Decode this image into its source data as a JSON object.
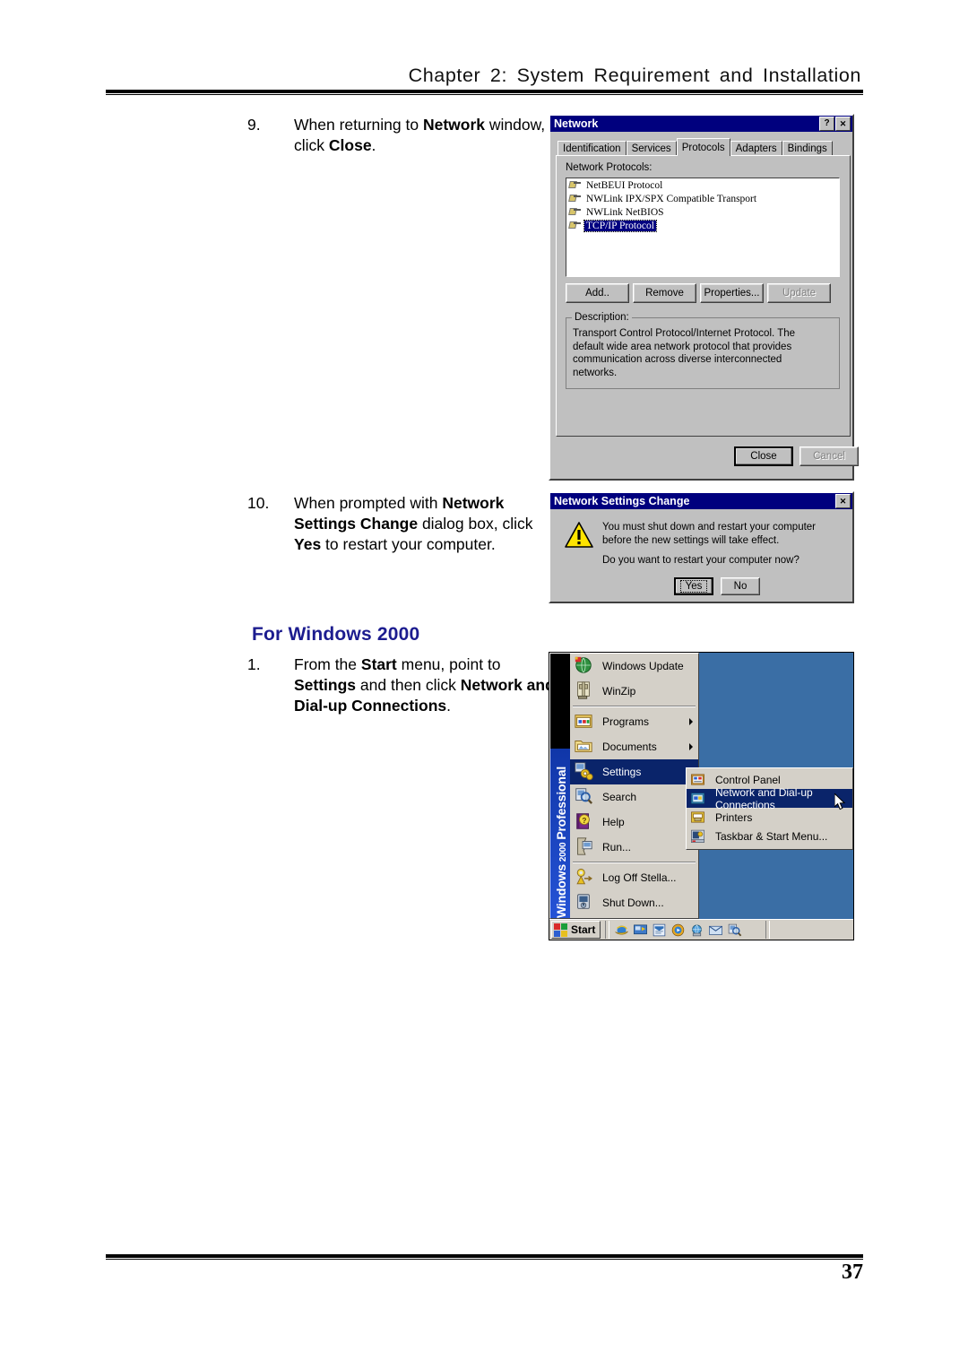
{
  "page": {
    "header_words": [
      "Chapter",
      "2:",
      "System",
      "Requirement",
      "and",
      "Installation"
    ],
    "header_full": "Chapter 2: System Requirement and Installation",
    "number": "37"
  },
  "steps": [
    {
      "number": "9.",
      "parts": [
        {
          "t": "When returning to ",
          "b": false
        },
        {
          "t": "Network",
          "b": true
        },
        {
          "t": " window, click ",
          "b": false
        },
        {
          "t": "Close",
          "b": true
        },
        {
          "t": ".",
          "b": false
        }
      ]
    },
    {
      "number": "10.",
      "parts": [
        {
          "t": "When prompted with ",
          "b": false
        },
        {
          "t": "Network Settings Change",
          "b": true
        },
        {
          "t": " dialog box, click ",
          "b": false
        },
        {
          "t": "Yes",
          "b": true
        },
        {
          "t": " to restart your computer.",
          "b": false
        }
      ]
    },
    {
      "number": "1.",
      "parts": [
        {
          "t": "From the ",
          "b": false
        },
        {
          "t": "Start",
          "b": true
        },
        {
          "t": " menu, point to ",
          "b": false
        },
        {
          "t": "Settings",
          "b": true
        },
        {
          "t": " and then click ",
          "b": false
        },
        {
          "t": "Network and Dial-up Connections",
          "b": true
        },
        {
          "t": ".",
          "b": false
        }
      ]
    }
  ],
  "section_heading": "For Windows 2000",
  "network_dialog": {
    "title": "Network",
    "help_button": "?",
    "close_button": "✕",
    "tabs": [
      {
        "label": "Identification",
        "active": false
      },
      {
        "label": "Services",
        "active": false
      },
      {
        "label": "Protocols",
        "active": true
      },
      {
        "label": "Adapters",
        "active": false
      },
      {
        "label": "Bindings",
        "active": false
      }
    ],
    "list_label": "Network Protocols:",
    "protocols": [
      {
        "name": "NetBEUI Protocol",
        "selected": false
      },
      {
        "name": "NWLink IPX/SPX Compatible Transport",
        "selected": false
      },
      {
        "name": "NWLink NetBIOS",
        "selected": false
      },
      {
        "name": "TCP/IP Protocol",
        "selected": true
      }
    ],
    "buttons": [
      {
        "label": "Add..",
        "disabled": false
      },
      {
        "label": "Remove",
        "disabled": false
      },
      {
        "label": "Properties...",
        "disabled": false
      },
      {
        "label": "Update",
        "disabled": true
      }
    ],
    "description_label": "Description:",
    "description_text": "Transport Control Protocol/Internet Protocol. The default wide area network protocol that provides communication across diverse interconnected networks.",
    "footer_buttons": [
      {
        "label": "Close",
        "disabled": false,
        "default": true
      },
      {
        "label": "Cancel",
        "disabled": true,
        "default": false
      }
    ]
  },
  "settings_change_dialog": {
    "title": "Network Settings Change",
    "close_button": "✕",
    "icon": "warning-icon",
    "message_line_1": "You must shut down and restart your computer before the new settings will take effect.",
    "message_line_2": "Do you want to restart your computer now?",
    "buttons": [
      {
        "label": "Yes",
        "default": true
      },
      {
        "label": "No",
        "default": false
      }
    ]
  },
  "start_menu": {
    "banner_main": "Windows",
    "banner_year": "2000",
    "banner_edition": "Professional",
    "items": [
      {
        "label": "Windows Update",
        "icon": "windows-update-icon",
        "arrow": false,
        "highlighted": false,
        "separator_after": false
      },
      {
        "label": "WinZip",
        "icon": "winzip-icon",
        "arrow": false,
        "highlighted": false,
        "separator_after": true
      },
      {
        "label": "Programs",
        "icon": "programs-icon",
        "arrow": true,
        "highlighted": false,
        "separator_after": false
      },
      {
        "label": "Documents",
        "icon": "documents-icon",
        "arrow": true,
        "highlighted": false,
        "separator_after": false
      },
      {
        "label": "Settings",
        "icon": "settings-icon",
        "arrow": true,
        "highlighted": true,
        "separator_after": false
      },
      {
        "label": "Search",
        "icon": "search-icon",
        "arrow": true,
        "highlighted": false,
        "separator_after": false
      },
      {
        "label": "Help",
        "icon": "help-icon",
        "arrow": false,
        "highlighted": false,
        "separator_after": false
      },
      {
        "label": "Run...",
        "icon": "run-icon",
        "arrow": false,
        "highlighted": false,
        "separator_after": true
      },
      {
        "label": "Log Off Stella...",
        "icon": "logoff-icon",
        "arrow": false,
        "highlighted": false,
        "separator_after": false
      },
      {
        "label": "Shut Down...",
        "icon": "shutdown-icon",
        "arrow": false,
        "highlighted": false,
        "separator_after": false
      }
    ],
    "submenu": [
      {
        "label": "Control Panel",
        "icon": "control-panel-icon",
        "highlighted": false
      },
      {
        "label": "Network and Dial-up Connections",
        "icon": "network-connections-icon",
        "highlighted": true
      },
      {
        "label": "Printers",
        "icon": "printers-icon",
        "highlighted": false
      },
      {
        "label": "Taskbar & Start Menu...",
        "icon": "taskbar-startmenu-icon",
        "highlighted": false
      }
    ],
    "taskbar": {
      "start_label": "Start",
      "quick_launch": [
        "internet-explorer-icon",
        "show-desktop-icon",
        "outlook-express-icon",
        "media-player-icon",
        "network-icon",
        "mail-icon",
        "search-icon"
      ]
    }
  },
  "colors": {
    "heading_blue": "#1c1c8f",
    "titlebar_blue": "#00007e",
    "menu_highlight": "#0a246a",
    "desktop_blue": "#3a6ea5",
    "dialog_face": "#c0c0c0",
    "menu_face": "#d4d0c8"
  }
}
